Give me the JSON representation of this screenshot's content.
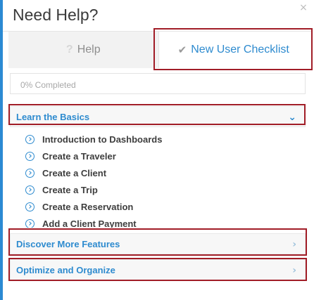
{
  "header": {
    "title": "Need Help?",
    "close_glyph": "×"
  },
  "tabs": [
    {
      "label": "Help",
      "icon": "question-icon",
      "icon_glyph": "?"
    },
    {
      "label": "New User Checklist",
      "icon": "checkmark-icon",
      "icon_glyph": "✔"
    }
  ],
  "progress": {
    "text": "0% Completed"
  },
  "sections": [
    {
      "label": "Learn the Basics",
      "expanded": true,
      "chevron": "⌄",
      "items": [
        "Introduction to Dashboards",
        "Create a Traveler",
        "Create a Client",
        "Create a Trip",
        "Create a Reservation",
        "Add a Client Payment"
      ]
    },
    {
      "label": "Discover More Features",
      "expanded": false,
      "chevron": "›"
    },
    {
      "label": "Optimize and Organize",
      "expanded": false,
      "chevron": "›"
    }
  ],
  "colors": {
    "accent": "#2e8bcf",
    "highlight_border": "#a11d27",
    "text_dark": "#3e3e3e",
    "left_bar": "#2b8ad3"
  }
}
